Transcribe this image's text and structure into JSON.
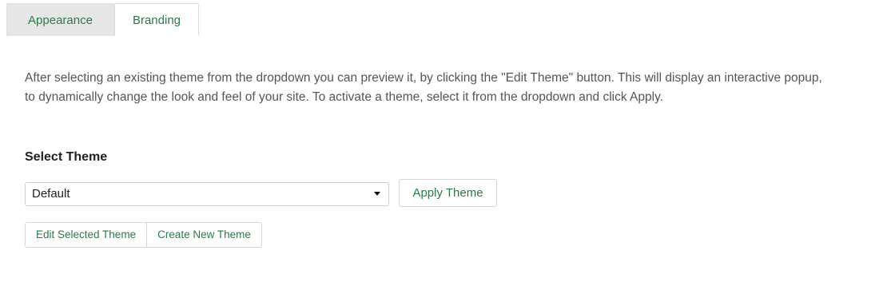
{
  "tabs": [
    {
      "label": "Appearance",
      "active": false
    },
    {
      "label": "Branding",
      "active": true
    }
  ],
  "description": "After selecting an existing theme from the dropdown you can preview it, by clicking the \"Edit Theme\" button. This will display an interactive popup, to dynamically change the look and feel of your site. To activate a theme, select it from the dropdown and click Apply.",
  "select_theme": {
    "label": "Select Theme",
    "selected_value": "Default",
    "apply_label": "Apply Theme"
  },
  "actions": {
    "edit_label": "Edit Selected Theme",
    "create_label": "Create New Theme"
  },
  "colors": {
    "accent": "#2a7a4a",
    "text": "#555555"
  }
}
